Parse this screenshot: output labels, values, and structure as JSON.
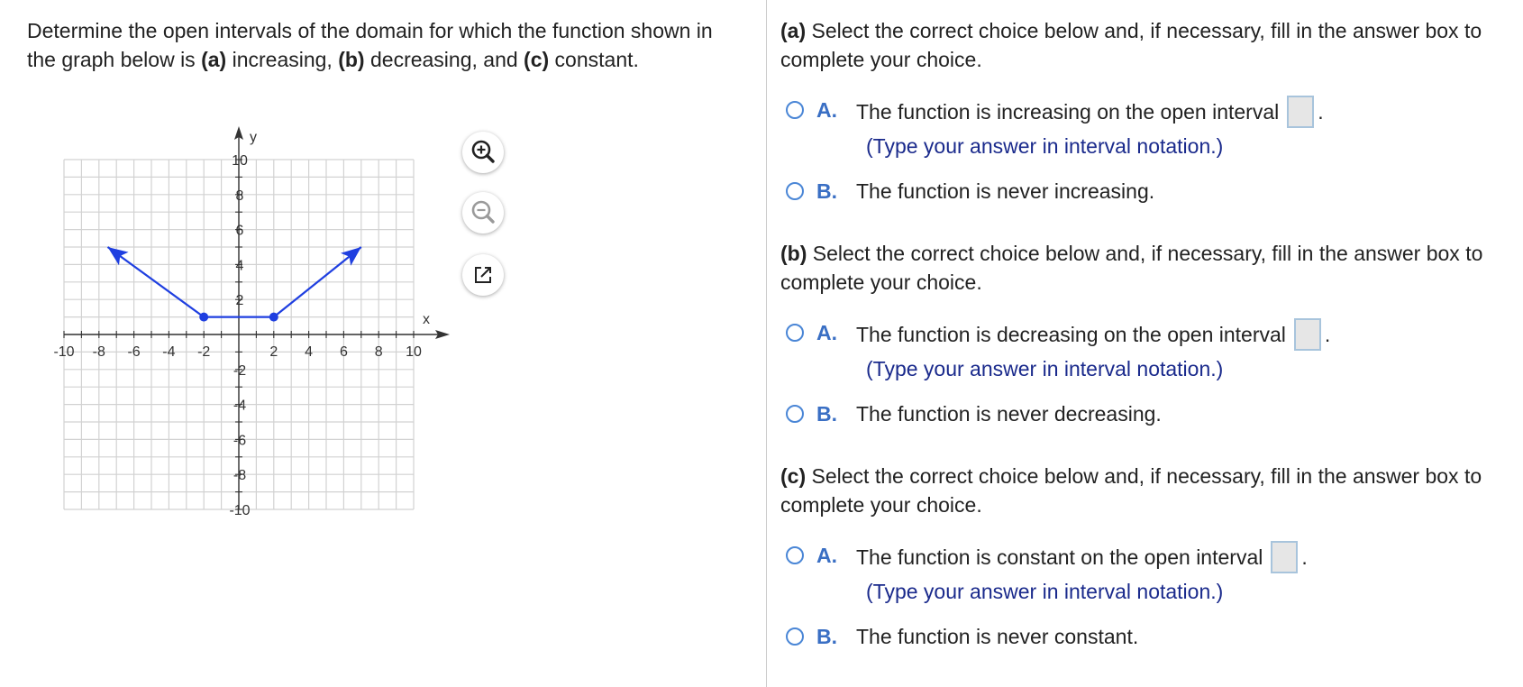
{
  "question": {
    "part1": "Determine the open intervals of the domain for which the function shown in the graph below is ",
    "a_label": "(a)",
    "a_text": " increasing, ",
    "b_label": "(b)",
    "b_text": " decreasing, and ",
    "c_label": "(c)",
    "c_text": " constant."
  },
  "graph": {
    "x_axis_label": "x",
    "y_axis_label": "y",
    "x_tick_labels": [
      "-10",
      "-8",
      "-6",
      "-4",
      "-2",
      "2",
      "4",
      "6",
      "8",
      "10"
    ],
    "y_tick_labels": [
      "10",
      "8",
      "6",
      "4",
      "2",
      "-2",
      "-4",
      "-6",
      "-8",
      "-10"
    ],
    "curve_color": "#1f3fe0",
    "points": [
      {
        "x": -7.5,
        "y": 5,
        "arrow": true
      },
      {
        "x": -2,
        "y": 1,
        "dot": true
      },
      {
        "x": 2,
        "y": 1,
        "dot": true
      },
      {
        "x": 7,
        "y": 5,
        "arrow": true
      }
    ],
    "xlim": [
      -10,
      10
    ],
    "ylim": [
      -10,
      10
    ]
  },
  "tools": {
    "zoom_in": "zoom-in-icon",
    "zoom_out": "zoom-out-icon",
    "popout": "popout-icon"
  },
  "parts": [
    {
      "label": "(a)",
      "heading": " Select the correct choice below and, if necessary, fill in the answer box to complete your choice.",
      "choice_a_letter": "A.",
      "choice_a_text": "The function is increasing on the open interval",
      "choice_a_hint": "(Type your answer in interval notation.)",
      "choice_b_letter": "B.",
      "choice_b_text": "The function is never increasing."
    },
    {
      "label": "(b)",
      "heading": " Select the correct choice below and, if necessary, fill in the answer box to complete your choice.",
      "choice_a_letter": "A.",
      "choice_a_text": "The function is decreasing on the open interval",
      "choice_a_hint": "(Type your answer in interval notation.)",
      "choice_b_letter": "B.",
      "choice_b_text": "The function is never decreasing."
    },
    {
      "label": "(c)",
      "heading": " Select the correct choice below and, if necessary, fill in the answer box to complete your choice.",
      "choice_a_letter": "A.",
      "choice_a_text": "The function is constant on the open interval",
      "choice_a_hint": "(Type your answer in interval notation.)",
      "choice_b_letter": "B.",
      "choice_b_text": "The function is never constant."
    }
  ],
  "period": "."
}
